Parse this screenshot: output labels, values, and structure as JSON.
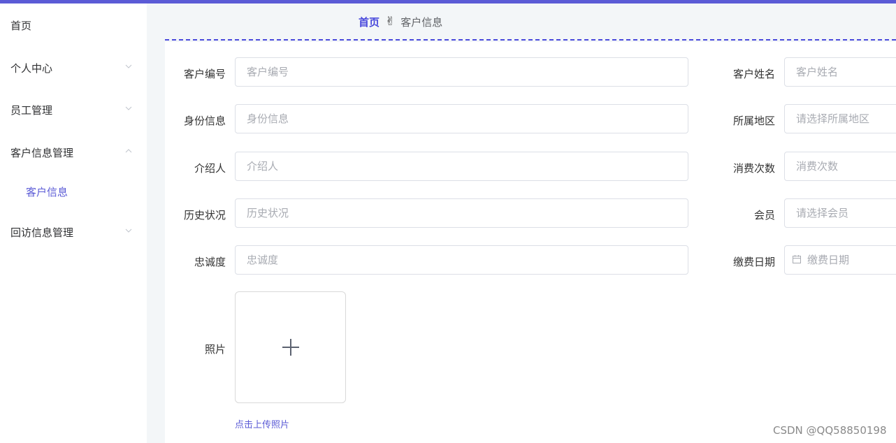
{
  "sidebar": {
    "items": [
      {
        "label": "首页"
      },
      {
        "label": "个人中心"
      },
      {
        "label": "员工管理"
      },
      {
        "label": "客户信息管理",
        "subitems": [
          {
            "label": "客户信息"
          }
        ]
      },
      {
        "label": "回访信息管理"
      }
    ]
  },
  "breadcrumb": {
    "home": "首页",
    "separator": "✌",
    "current": "客户信息"
  },
  "form": {
    "customer_no": {
      "label": "客户编号",
      "placeholder": "客户编号"
    },
    "customer_name": {
      "label": "客户姓名",
      "placeholder": "客户姓名"
    },
    "id_info": {
      "label": "身份信息",
      "placeholder": "身份信息"
    },
    "region": {
      "label": "所属地区",
      "placeholder": "请选择所属地区"
    },
    "referrer": {
      "label": "介绍人",
      "placeholder": "介绍人"
    },
    "consume_count": {
      "label": "消费次数",
      "placeholder": "消费次数"
    },
    "history": {
      "label": "历史状况",
      "placeholder": "历史状况"
    },
    "member": {
      "label": "会员",
      "placeholder": "请选择会员"
    },
    "loyalty": {
      "label": "忠诚度",
      "placeholder": "忠诚度"
    },
    "pay_date": {
      "label": "缴费日期",
      "placeholder": "缴费日期"
    },
    "photo": {
      "label": "照片",
      "hint": "点击上传照片"
    }
  },
  "watermark": "CSDN @QQ58850198",
  "colors": {
    "accent": "#5b5bd6",
    "breadcrumb_home": "#4a4adc",
    "main_bg": "#f3f6f8"
  }
}
